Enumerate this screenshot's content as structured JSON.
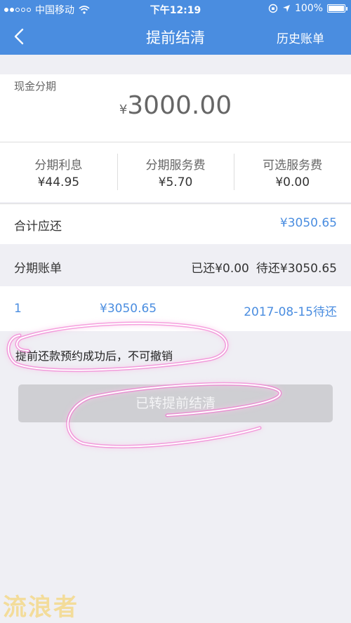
{
  "status_bar": {
    "carrier": "中国移动",
    "time": "下午12:19",
    "battery": "100%",
    "icons": [
      "signal-dots-icon",
      "wifi-icon",
      "orientation-lock-icon",
      "location-arrow-icon",
      "battery-icon"
    ]
  },
  "nav": {
    "back_icon": "chevron-left-icon",
    "title": "提前结清",
    "right_label": "历史账单"
  },
  "amount": {
    "label": "现金分期",
    "currency": "¥",
    "value": "3000.00"
  },
  "fees": [
    {
      "label": "分期利息",
      "value": "¥44.95"
    },
    {
      "label": "分期服务费",
      "value": "¥5.70"
    },
    {
      "label": "可选服务费",
      "value": "¥0.00"
    }
  ],
  "total": {
    "label": "合计应还",
    "value": "¥3050.65"
  },
  "bill": {
    "label": "分期账单",
    "paid": "已还¥0.00",
    "pending": "待还¥3050.65",
    "items": [
      {
        "index": "1",
        "amount": "¥3050.65",
        "date_status": "2017-08-15待还"
      }
    ]
  },
  "notice": "提前还款预约成功后，不可撤销",
  "button_label": "已转提前结清",
  "watermark": "流浪者",
  "colors": {
    "primary": "#4a8de0",
    "annotation": "#e35cc8",
    "button_disabled": "#cfcfd3"
  }
}
